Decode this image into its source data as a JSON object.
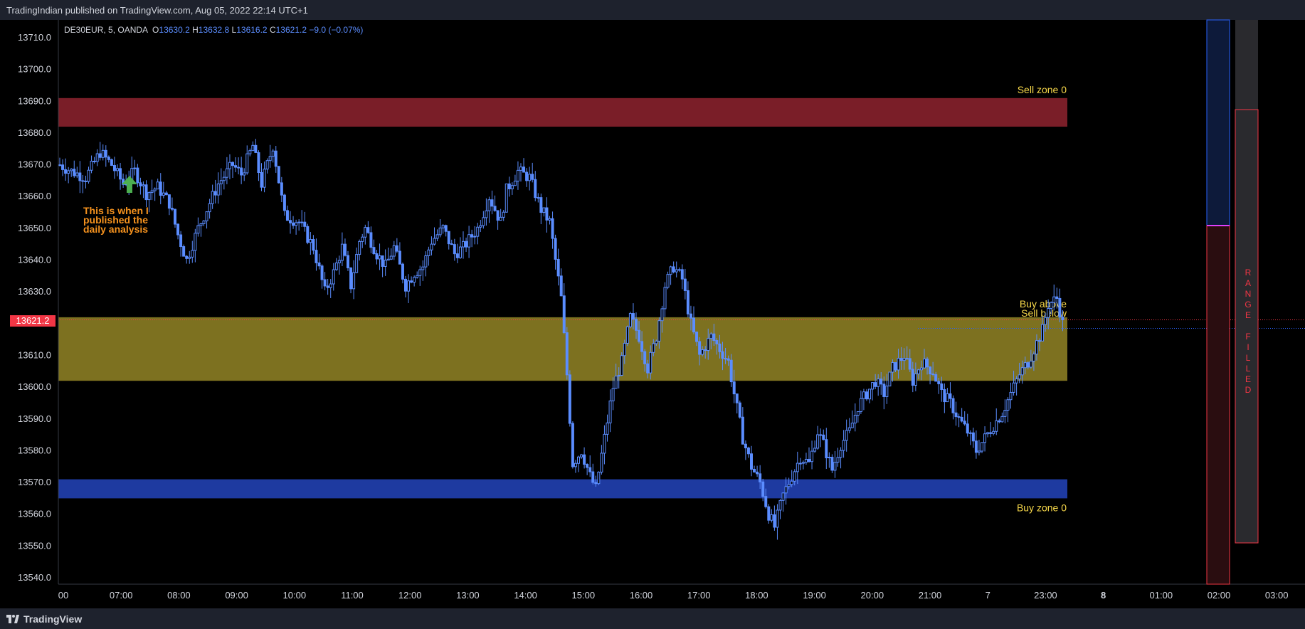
{
  "header": {
    "publisher_text": "TradingIndian published on TradingView.com, Aug 05, 2022 22:14 UTC+1"
  },
  "footer": {
    "logo_text": "TradingView"
  },
  "legend": {
    "symbol": "DE30EUR, 5, OANDA",
    "open_label": "O",
    "open": "13630.2",
    "high_label": "H",
    "high": "13632.8",
    "low_label": "L",
    "low": "13616.2",
    "close_label": "C",
    "close": "13621.2",
    "change": "−9.0 (−0.07%)"
  },
  "price_tag": "13621.2",
  "annotation": [
    "This is when I",
    "published the",
    "daily analysis"
  ],
  "zone_labels": {
    "sell_zone": "Sell zone 0",
    "buy_above": "Buy above",
    "sell_below": "Sell below",
    "buy_zone": "Buy zone 0"
  },
  "range_label": [
    "R",
    "A",
    "N",
    "G",
    "E",
    "",
    "F",
    "I",
    "L",
    "L",
    "E",
    "D"
  ],
  "colors": {
    "background": "#000000",
    "candle": "#5b8dff",
    "sell_zone": "#7a1e28",
    "mid_zone": "#7d7120",
    "buy_zone": "#1e3aa0",
    "zone_text": "#f7d84a",
    "annotation": "#f7931e",
    "arrow": "#4caf50",
    "price_tag": "#f23645"
  },
  "chart_data": {
    "type": "candlestick",
    "symbol": "DE30EUR",
    "timeframe": "5",
    "y_ticks": [
      13710.0,
      13700.0,
      13690.0,
      13680.0,
      13670.0,
      13660.0,
      13650.0,
      13640.0,
      13630.0,
      13620.0,
      13610.0,
      13600.0,
      13590.0,
      13580.0,
      13570.0,
      13560.0,
      13550.0,
      13540.0
    ],
    "ylim": [
      13538,
      13712
    ],
    "x_ticks": [
      {
        "label": "00",
        "bold": false
      },
      {
        "label": "07:00",
        "bold": false
      },
      {
        "label": "08:00",
        "bold": false
      },
      {
        "label": "09:00",
        "bold": false
      },
      {
        "label": "10:00",
        "bold": false
      },
      {
        "label": "11:00",
        "bold": false
      },
      {
        "label": "12:00",
        "bold": false
      },
      {
        "label": "13:00",
        "bold": false
      },
      {
        "label": "14:00",
        "bold": false
      },
      {
        "label": "15:00",
        "bold": false
      },
      {
        "label": "16:00",
        "bold": false
      },
      {
        "label": "17:00",
        "bold": false
      },
      {
        "label": "18:00",
        "bold": false
      },
      {
        "label": "19:00",
        "bold": false
      },
      {
        "label": "20:00",
        "bold": false
      },
      {
        "label": "21:00",
        "bold": false
      },
      {
        "label": "7",
        "bold": false
      },
      {
        "label": "23:00",
        "bold": false
      },
      {
        "label": "8",
        "bold": true
      },
      {
        "label": "01:00",
        "bold": false
      },
      {
        "label": "02:00",
        "bold": false
      },
      {
        "label": "03:00",
        "bold": false
      }
    ],
    "zones": [
      {
        "name": "Sell zone 0",
        "low": 13682,
        "high": 13691
      },
      {
        "name": "Buy above / Sell below",
        "low": 13602,
        "high": 13622
      },
      {
        "name": "Buy zone 0",
        "low": 13565,
        "high": 13571
      }
    ],
    "last_price": 13621.2,
    "path": [
      [
        0,
        13670
      ],
      [
        4,
        13668
      ],
      [
        9,
        13666
      ],
      [
        14,
        13674
      ],
      [
        18,
        13670
      ],
      [
        22,
        13664
      ],
      [
        26,
        13668
      ],
      [
        30,
        13661
      ],
      [
        34,
        13663
      ],
      [
        38,
        13658
      ],
      [
        41,
        13648
      ],
      [
        44,
        13640
      ],
      [
        48,
        13650
      ],
      [
        52,
        13658
      ],
      [
        55,
        13664
      ],
      [
        60,
        13670
      ],
      [
        63,
        13667
      ],
      [
        67,
        13676
      ],
      [
        70,
        13664
      ],
      [
        74,
        13676
      ],
      [
        78,
        13654
      ],
      [
        83,
        13652
      ],
      [
        88,
        13644
      ],
      [
        92,
        13630
      ],
      [
        95,
        13636
      ],
      [
        98,
        13644
      ],
      [
        101,
        13632
      ],
      [
        104,
        13646
      ],
      [
        106,
        13650
      ],
      [
        110,
        13642
      ],
      [
        113,
        13638
      ],
      [
        116,
        13644
      ],
      [
        120,
        13632
      ],
      [
        123,
        13636
      ],
      [
        126,
        13638
      ],
      [
        129,
        13646
      ],
      [
        133,
        13650
      ],
      [
        137,
        13642
      ],
      [
        140,
        13644
      ],
      [
        145,
        13650
      ],
      [
        149,
        13660
      ],
      [
        153,
        13652
      ],
      [
        155,
        13662
      ],
      [
        159,
        13668
      ],
      [
        163,
        13666
      ],
      [
        167,
        13656
      ],
      [
        170,
        13652
      ],
      [
        174,
        13628
      ],
      [
        176,
        13604
      ],
      [
        178,
        13576
      ],
      [
        181,
        13580
      ],
      [
        184,
        13572
      ],
      [
        186,
        13568
      ],
      [
        189,
        13584
      ],
      [
        192,
        13600
      ],
      [
        195,
        13608
      ],
      [
        198,
        13622
      ],
      [
        201,
        13616
      ],
      [
        204,
        13606
      ],
      [
        207,
        13616
      ],
      [
        210,
        13632
      ],
      [
        213,
        13638
      ],
      [
        216,
        13634
      ],
      [
        219,
        13620
      ],
      [
        222,
        13610
      ],
      [
        226,
        13616
      ],
      [
        229,
        13612
      ],
      [
        232,
        13608
      ],
      [
        234,
        13598
      ],
      [
        237,
        13584
      ],
      [
        240,
        13575
      ],
      [
        243,
        13570
      ],
      [
        246,
        13560
      ],
      [
        248,
        13556
      ],
      [
        251,
        13566
      ],
      [
        254,
        13572
      ],
      [
        257,
        13578
      ],
      [
        260,
        13576
      ],
      [
        263,
        13586
      ],
      [
        265,
        13582
      ],
      [
        268,
        13574
      ],
      [
        271,
        13582
      ],
      [
        274,
        13586
      ],
      [
        277,
        13594
      ],
      [
        280,
        13598
      ],
      [
        283,
        13602
      ],
      [
        286,
        13598
      ],
      [
        289,
        13606
      ],
      [
        293,
        13610
      ],
      [
        296,
        13602
      ],
      [
        299,
        13608
      ],
      [
        303,
        13605
      ],
      [
        306,
        13598
      ],
      [
        309,
        13595
      ],
      [
        312,
        13590
      ],
      [
        315,
        13586
      ],
      [
        318,
        13580
      ],
      [
        321,
        13584
      ],
      [
        324,
        13588
      ],
      [
        327,
        13592
      ],
      [
        330,
        13598
      ],
      [
        333,
        13604
      ],
      [
        336,
        13608
      ],
      [
        338,
        13612
      ],
      [
        341,
        13618
      ],
      [
        343,
        13626
      ],
      [
        346,
        13628
      ],
      [
        348,
        13620
      ]
    ]
  }
}
